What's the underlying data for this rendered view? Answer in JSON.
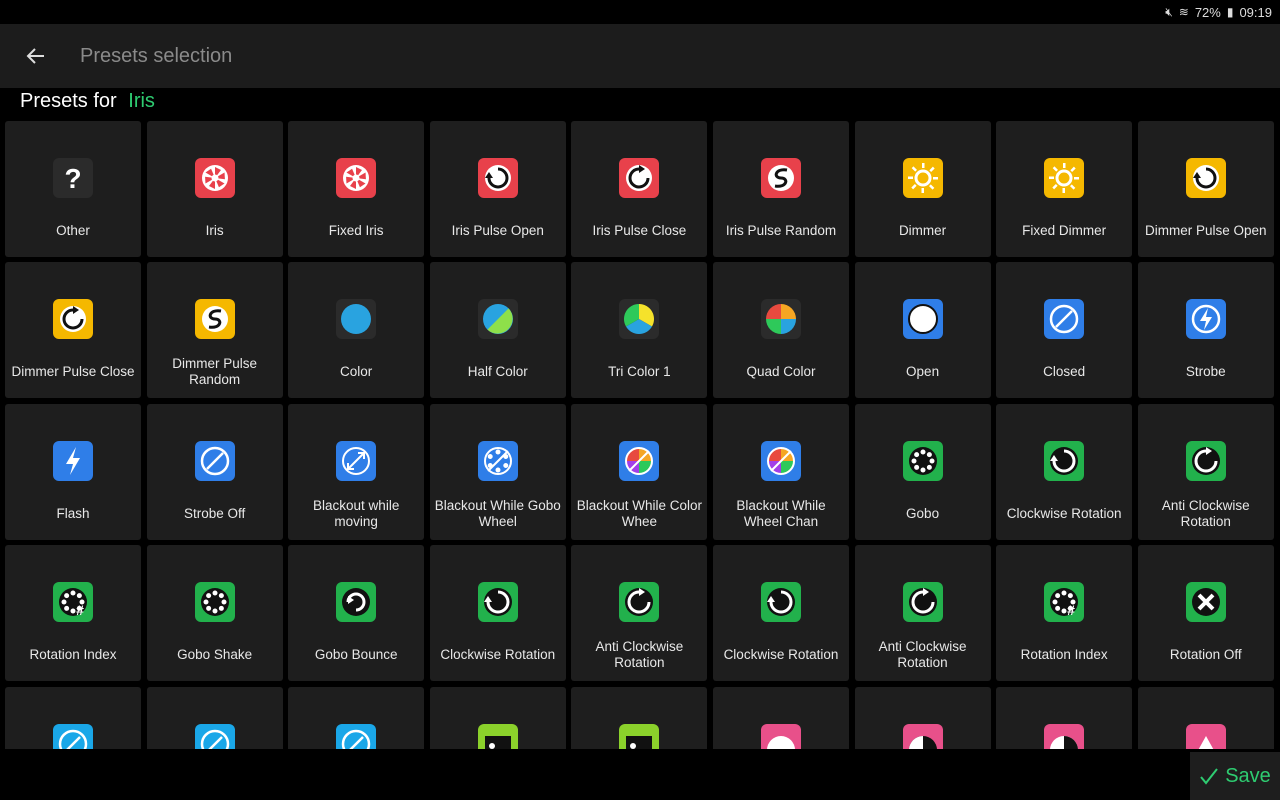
{
  "status": {
    "mute_icon": "mute-icon",
    "wifi_icon": "wifi-icon",
    "battery": "72%",
    "battery_icon": "battery-icon",
    "time": "09:19"
  },
  "appbar": {
    "title": "Presets selection",
    "back_icon": "arrow-left-icon"
  },
  "header": {
    "prefix": "Presets for",
    "fixture": "Iris"
  },
  "presets": [
    {
      "label": "Other",
      "icon": "question",
      "color": "#2b2b2b"
    },
    {
      "label": "Iris",
      "icon": "aperture",
      "color": "#e8414b"
    },
    {
      "label": "Fixed Iris",
      "icon": "aperture",
      "color": "#e8414b"
    },
    {
      "label": "Iris Pulse Open",
      "icon": "pulse-open",
      "color": "#e8414b"
    },
    {
      "label": "Iris Pulse Close",
      "icon": "pulse-close",
      "color": "#e8414b"
    },
    {
      "label": "Iris Pulse Random",
      "icon": "pulse-random",
      "color": "#e8414b"
    },
    {
      "label": "Dimmer",
      "icon": "sun",
      "color": "#f5b800"
    },
    {
      "label": "Fixed Dimmer",
      "icon": "sun",
      "color": "#f5b800"
    },
    {
      "label": "Dimmer Pulse Open",
      "icon": "pulse-open",
      "color": "#f5b800"
    },
    {
      "label": "Dimmer Pulse Close",
      "icon": "pulse-close",
      "color": "#f5b800"
    },
    {
      "label": "Dimmer Pulse Random",
      "icon": "pulse-random",
      "color": "#f5b800"
    },
    {
      "label": "Color",
      "icon": "color",
      "color": "#2b2b2b"
    },
    {
      "label": "Half Color",
      "icon": "half-color",
      "color": "#2b2b2b"
    },
    {
      "label": "Tri Color 1",
      "icon": "tri-color",
      "color": "#2b2b2b"
    },
    {
      "label": "Quad Color",
      "icon": "quad-color",
      "color": "#2b2b2b"
    },
    {
      "label": "Open",
      "icon": "open",
      "color": "#2f7ee8"
    },
    {
      "label": "Closed",
      "icon": "closed",
      "color": "#2f7ee8"
    },
    {
      "label": "Strobe",
      "icon": "bolt-circle",
      "color": "#2f7ee8"
    },
    {
      "label": "Flash",
      "icon": "bolt",
      "color": "#2f7ee8"
    },
    {
      "label": "Strobe Off",
      "icon": "closed",
      "color": "#2f7ee8"
    },
    {
      "label": "Blackout while moving",
      "icon": "blackout-move",
      "color": "#2f7ee8"
    },
    {
      "label": "Blackout While Gobo Wheel",
      "icon": "blackout-gobo",
      "color": "#2f7ee8"
    },
    {
      "label": "Blackout While Color Whee",
      "icon": "blackout-color",
      "color": "#2f7ee8"
    },
    {
      "label": "Blackout While Wheel Chan",
      "icon": "blackout-color",
      "color": "#2f7ee8"
    },
    {
      "label": "Gobo",
      "icon": "gobo",
      "color": "#22b14c"
    },
    {
      "label": "Clockwise Rotation",
      "icon": "cw",
      "color": "#22b14c"
    },
    {
      "label": "Anti Clockwise Rotation",
      "icon": "ccw",
      "color": "#22b14c"
    },
    {
      "label": "Rotation Index",
      "icon": "gobo-index",
      "color": "#22b14c"
    },
    {
      "label": "Gobo Shake",
      "icon": "gobo",
      "color": "#22b14c"
    },
    {
      "label": "Gobo Bounce",
      "icon": "bounce",
      "color": "#22b14c"
    },
    {
      "label": "Clockwise Rotation",
      "icon": "cw",
      "color": "#22b14c"
    },
    {
      "label": "Anti Clockwise Rotation",
      "icon": "ccw",
      "color": "#22b14c"
    },
    {
      "label": "Clockwise Rotation",
      "icon": "cw",
      "color": "#22b14c"
    },
    {
      "label": "Anti Clockwise Rotation",
      "icon": "ccw",
      "color": "#22b14c"
    },
    {
      "label": "Rotation Index",
      "icon": "gobo-index",
      "color": "#22b14c"
    },
    {
      "label": "Rotation Off",
      "icon": "cross",
      "color": "#22b14c"
    },
    {
      "label": "",
      "icon": "compass",
      "color": "#1aa7e8"
    },
    {
      "label": "",
      "icon": "compass",
      "color": "#1aa7e8"
    },
    {
      "label": "",
      "icon": "compass",
      "color": "#1aa7e8"
    },
    {
      "label": "",
      "icon": "prism",
      "color": "#8bd12b"
    },
    {
      "label": "",
      "icon": "prism",
      "color": "#8bd12b"
    },
    {
      "label": "",
      "icon": "white-circle",
      "color": "#e8508a"
    },
    {
      "label": "",
      "icon": "half-white",
      "color": "#e8508a"
    },
    {
      "label": "",
      "icon": "quarter-white",
      "color": "#e8508a"
    },
    {
      "label": "",
      "icon": "drop",
      "color": "#e8508a"
    }
  ],
  "save": {
    "label": "Save",
    "icon": "check-icon"
  }
}
